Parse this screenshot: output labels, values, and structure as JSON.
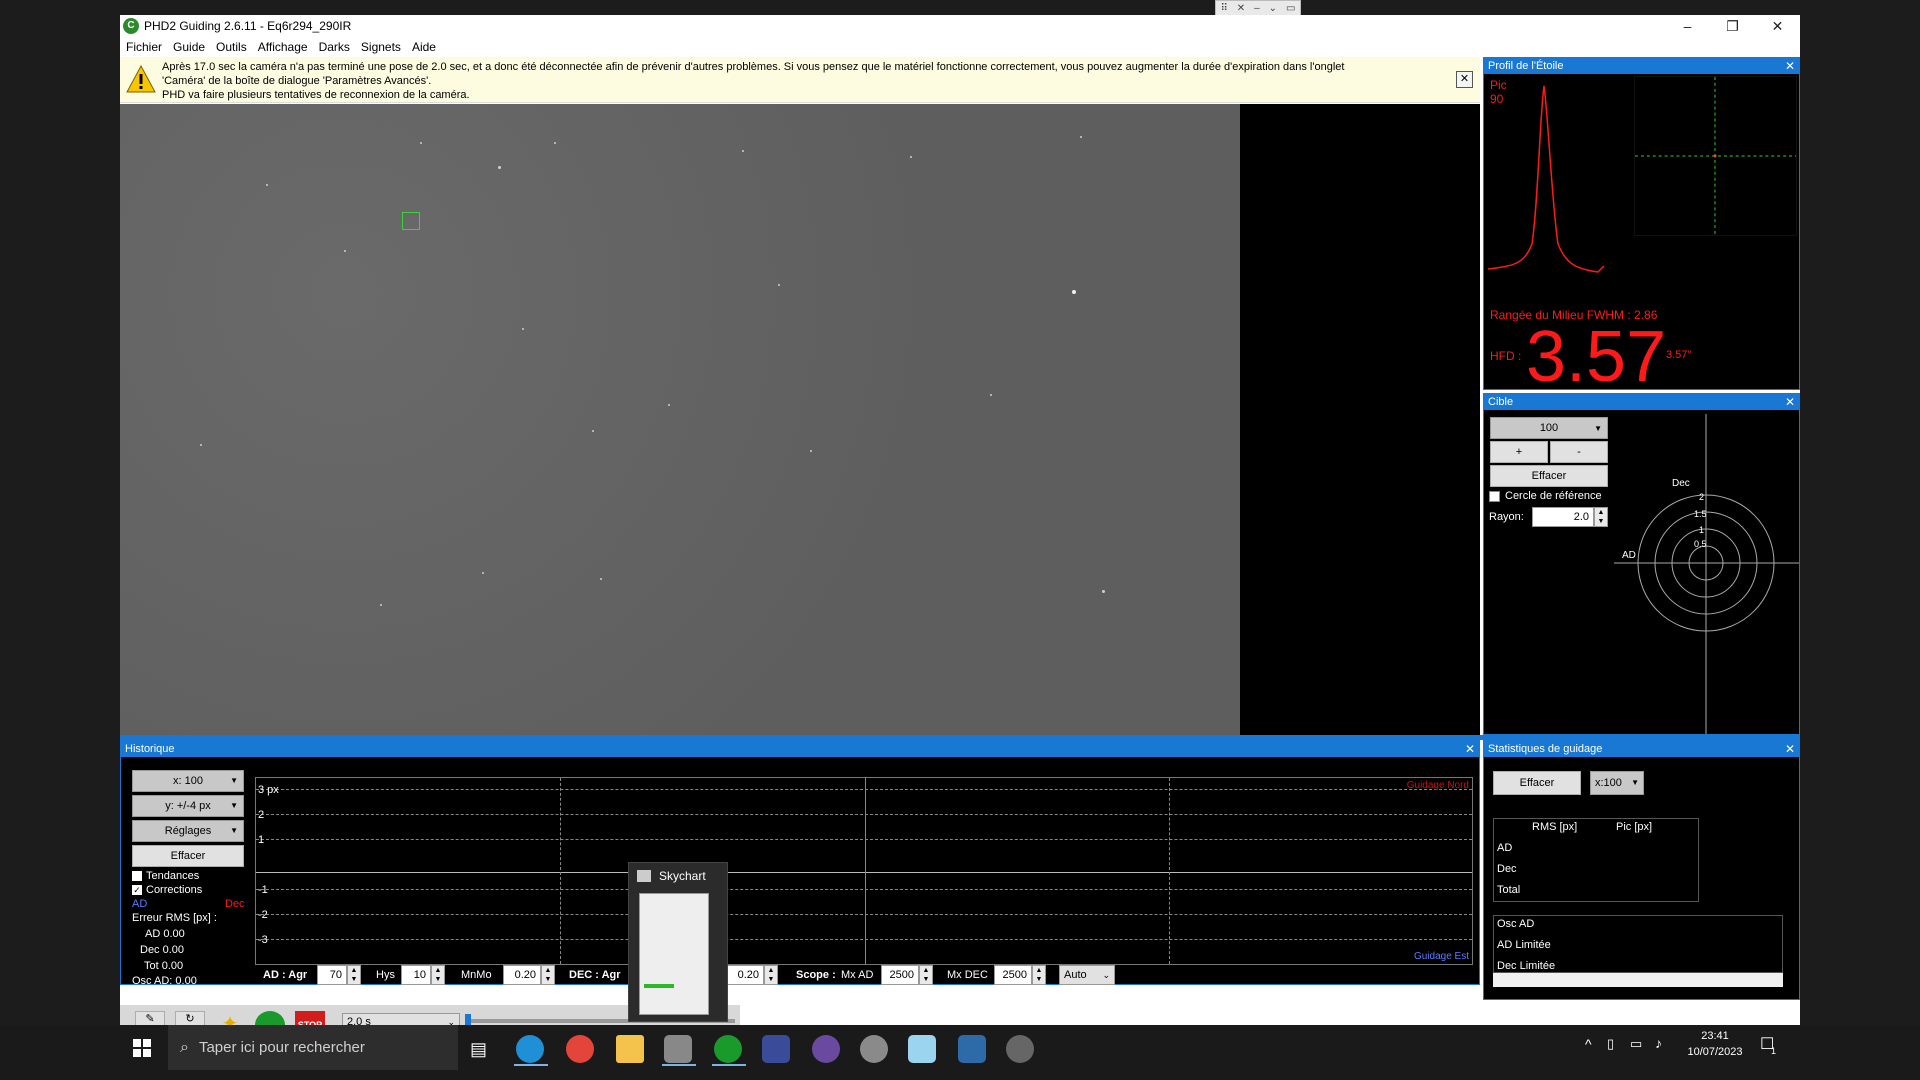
{
  "window": {
    "title": "PHD2 Guiding 2.6.11 - Eq6r294_290IR"
  },
  "menu": [
    "Fichier",
    "Guide",
    "Outils",
    "Affichage",
    "Darks",
    "Signets",
    "Aide"
  ],
  "info": {
    "line1": "Après 17.0 sec la caméra n'a pas terminé une pose de 2.0 sec, et a donc été déconnectée afin de prévenir d'autres problèmes. Si vous pensez que le matériel fonctionne correctement, vous pouvez augmenter la durée d'expiration dans l'onglet",
    "line2": "'Caméra' de la boîte de dialogue 'Paramètres Avancés'.",
    "line3": "PHD va faire plusieurs tentatives de reconnexion de la caméra."
  },
  "profile": {
    "title": "Profil de l'Étoile",
    "pic_label": "Pic",
    "pic_value": "90",
    "fwhm": "Rangée du Milieu FWHM : 2.86",
    "hfd_label": "HFD :",
    "hfd_value": "3.57",
    "hfd_arcsec": "3.57\""
  },
  "cible": {
    "title": "Cible",
    "zoom": "100",
    "plus": "+",
    "minus": "-",
    "clear": "Effacer",
    "ref_circle": "Cercle de référence",
    "radius_label": "Rayon:",
    "radius_value": "2.0",
    "dec_label": "Dec",
    "ad_label": "AD",
    "rings": [
      "2",
      "1.5",
      "1",
      "0.5"
    ]
  },
  "history": {
    "title": "Historique",
    "x_scale": "x: 100",
    "y_scale": "y: +/-4 px",
    "settings": "Réglages",
    "clear": "Effacer",
    "trends": "Tendances",
    "corrections": "Corrections",
    "ad": "AD",
    "dec": "Dec",
    "rms_title": "Erreur RMS [px] :",
    "rms_ad": "AD 0.00",
    "rms_dec": "Dec 0.00",
    "rms_tot": "Tot 0.00",
    "osc_ad": "Osc AD: 0.00",
    "y_labels": [
      "3 px",
      "2",
      "1",
      "-1",
      "-2",
      "-3"
    ],
    "guide_north": "Guidage Nord",
    "guide_east": "Guidage Est",
    "ad_agr_label": "AD : Agr",
    "ad_agr": "70",
    "hys_label": "Hys",
    "hys": "10",
    "mnmo_label": "MnMo",
    "mnmo": "0.20",
    "dec_agr_label": "DEC : Agr",
    "dec_mnmo": "0.20",
    "scope_label": "Scope :",
    "mx_ad_label": "Mx AD",
    "mx_ad": "2500",
    "mx_dec_label": "Mx DEC",
    "mx_dec": "2500",
    "dec_mode": "Auto"
  },
  "stats": {
    "title": "Statistiques de guidage",
    "clear": "Effacer",
    "scale": "x:100",
    "col_rms": "RMS [px]",
    "col_pic": "Pic [px]",
    "rows": [
      "AD",
      "Dec",
      "Total"
    ],
    "rows2": [
      "Osc AD",
      "AD Limitée",
      "Dec Limitée"
    ]
  },
  "toolbar": {
    "exposure": "2.0 s"
  },
  "skychart": {
    "label": "Skychart"
  },
  "taskbar": {
    "search_placeholder": "Taper ici pour rechercher",
    "time": "23:41",
    "date": "10/07/2023",
    "notif_count": "1"
  },
  "colors": {
    "accent": "#1978d4",
    "hfd": "#ff1a1a",
    "star_green": "#3bd13b"
  }
}
